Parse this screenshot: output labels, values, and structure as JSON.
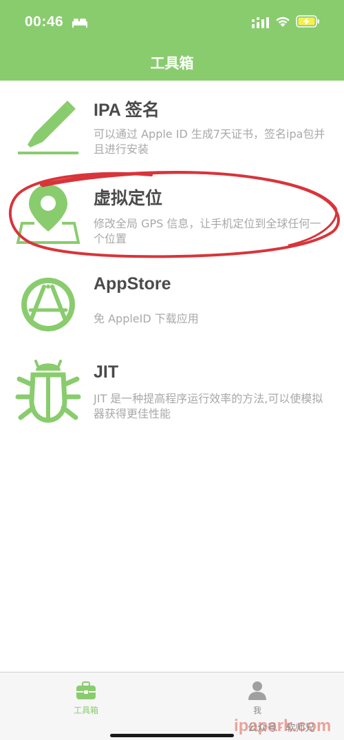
{
  "status_bar": {
    "time": "00:46"
  },
  "header": {
    "title": "工具箱"
  },
  "tools": [
    {
      "title": "IPA 签名",
      "description": "可以通过 Apple ID 生成7天证书，签名ipa包并且进行安装"
    },
    {
      "title": "虚拟定位",
      "description": "修改全局 GPS 信息，让手机定位到全球任何一个位置"
    },
    {
      "title": "AppStore",
      "description": "免 AppleID 下载应用"
    },
    {
      "title": "JIT",
      "description": "JIT 是一种提高程序运行效率的方法,可以使模拟器获得更佳性能"
    }
  ],
  "tab_bar": {
    "tabs": [
      {
        "label": "工具箱",
        "icon": "toolbox-icon",
        "active": true
      },
      {
        "label": "我",
        "icon": "person-icon",
        "active": false
      }
    ]
  },
  "watermark": {
    "account": "公众号 · 软师兄",
    "site": "ipapark.com"
  },
  "colors": {
    "accent": "#89cc6e",
    "title_text": "#4a4a4a",
    "desc_text": "#a8a8a8",
    "annotation": "#d8343a"
  }
}
